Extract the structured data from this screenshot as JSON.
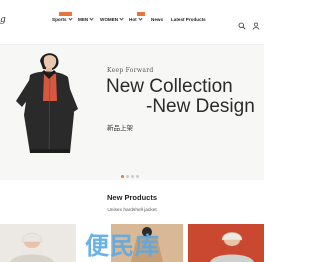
{
  "brand": {
    "logo_text": "g"
  },
  "nav": {
    "items": [
      {
        "label": "Sports",
        "badge": "",
        "has_dropdown": true
      },
      {
        "label": "MEN",
        "has_dropdown": true
      },
      {
        "label": "WOMEN",
        "has_dropdown": true
      },
      {
        "label": "Hot",
        "badge": "",
        "has_dropdown": true
      },
      {
        "label": "News",
        "has_dropdown": false
      },
      {
        "label": "Latest Products",
        "has_dropdown": false
      }
    ]
  },
  "header_icons": [
    "search-icon",
    "user-icon"
  ],
  "hero": {
    "kicker": "Keep Forward",
    "headline_line1": "New Collection",
    "headline_line2": "-New Design",
    "subtitle": "新品上架",
    "slide_count": 4,
    "active_slide": 1
  },
  "products": {
    "title": "New Products",
    "subtitle": "Unisex hardshell jacket"
  },
  "watermark": "便民库",
  "colors": {
    "accent": "#e8743b",
    "text": "#222222",
    "jacket": "#2a2a2a",
    "inner": "#d9573f"
  }
}
